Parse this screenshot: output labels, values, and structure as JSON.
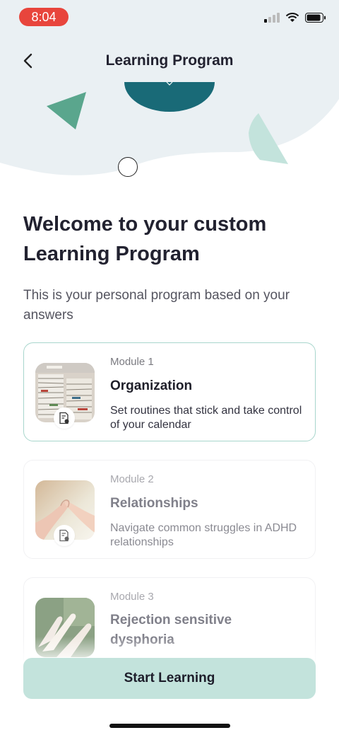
{
  "status_bar": {
    "time": "8:04"
  },
  "nav": {
    "title": "Learning Program"
  },
  "intro": {
    "heading": "Welcome to your custom Learning Program",
    "subtitle": "This is your personal program based on your answers"
  },
  "modules": [
    {
      "label": "Module 1",
      "title": "Organization",
      "description": "Set routines that stick and take control of your calendar",
      "icon": "document-audio-icon"
    },
    {
      "label": "Module 2",
      "title": "Relationships",
      "description": "Navigate common struggles in ADHD relationships",
      "icon": "document-audio-icon"
    },
    {
      "label": "Module 3",
      "title": "Rejection sensitive dysphoria",
      "description": "",
      "icon": "document-audio-icon"
    }
  ],
  "cta": {
    "label": "Start Learning"
  },
  "colors": {
    "time_pill": "#e8453c",
    "header_bg": "#eaf0f3",
    "teal_dark": "#196a77",
    "mint": "#c3e3dc",
    "triangle": "#5aa68d",
    "active_border": "#a8d6cc"
  }
}
